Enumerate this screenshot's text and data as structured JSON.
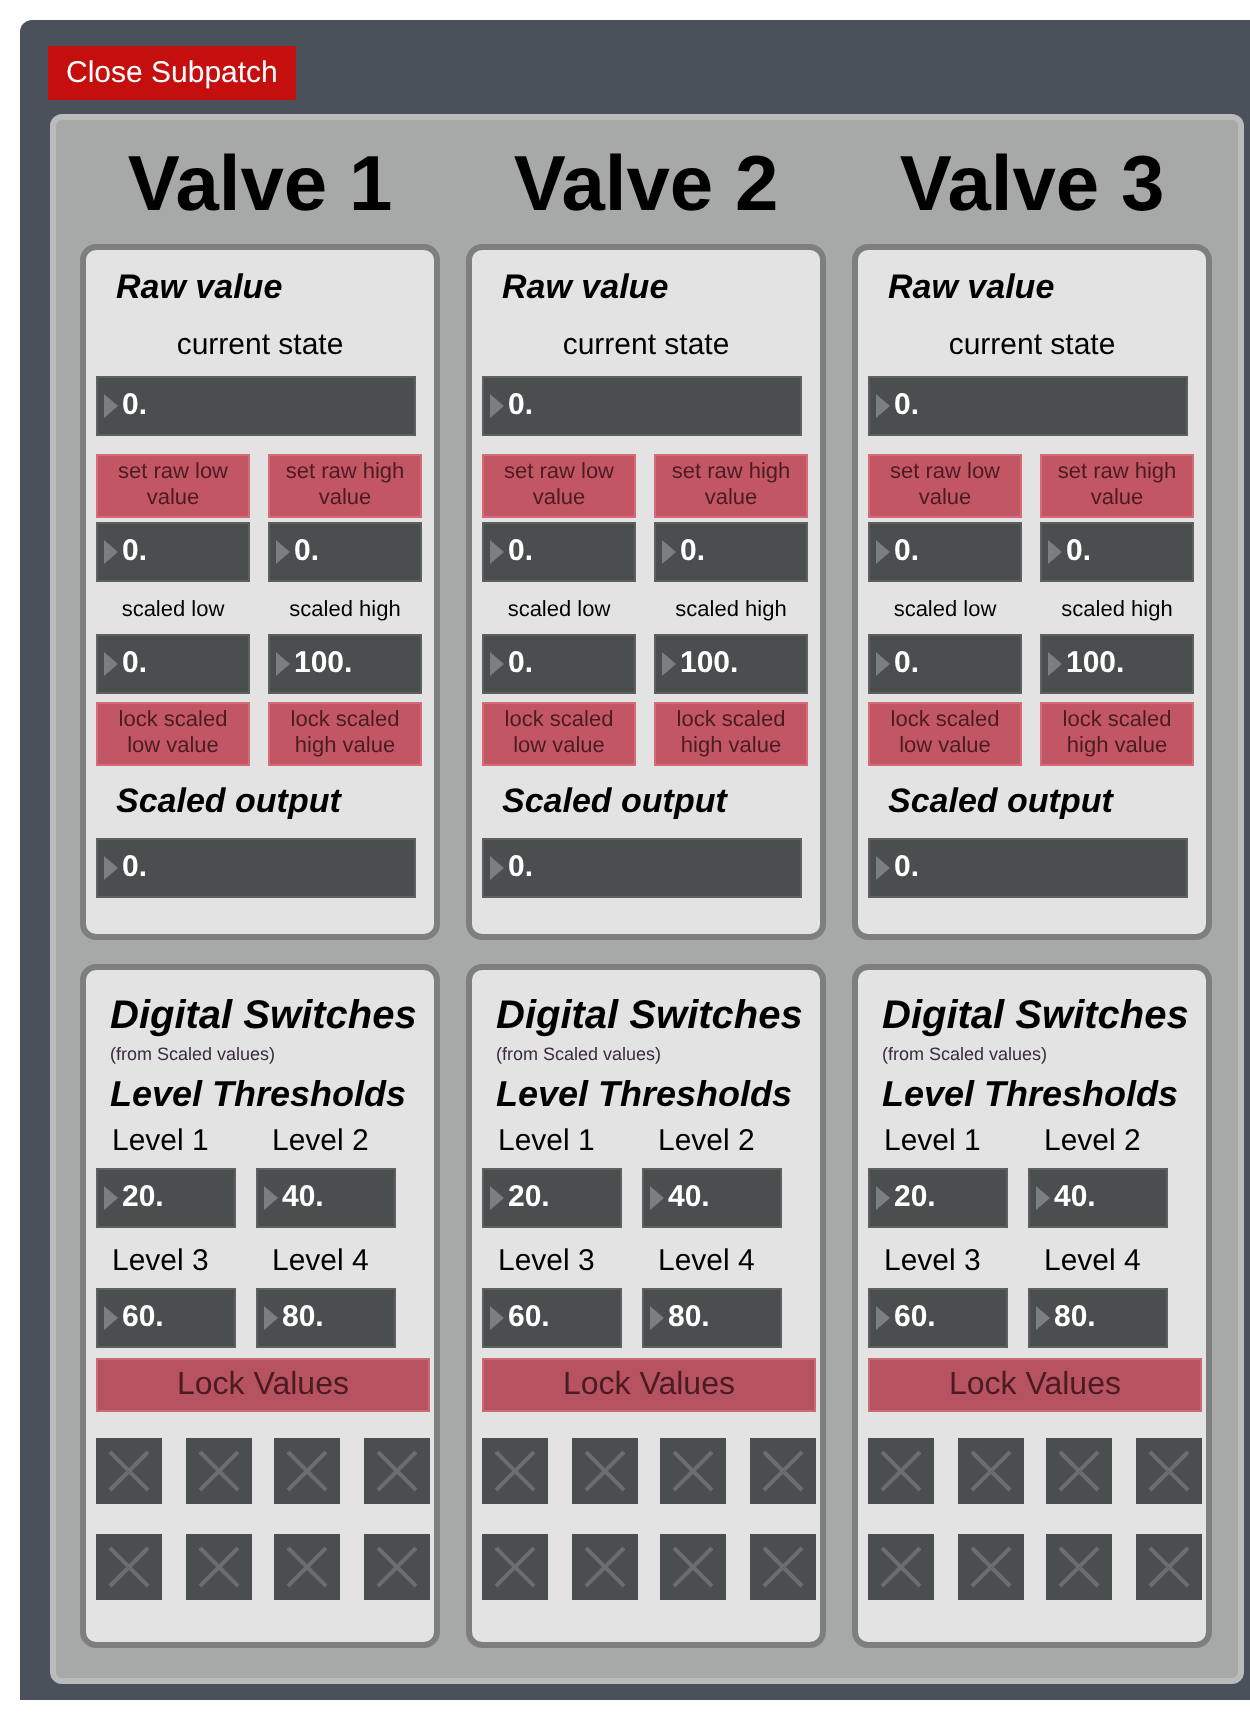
{
  "close_button": "Close Subpatch",
  "valves": [
    {
      "title": "Valve 1",
      "raw": {
        "heading": "Raw value",
        "current_label": "current state",
        "current": "0.",
        "set_low": "set raw low value",
        "set_high": "set raw high value",
        "raw_low": "0.",
        "raw_high": "0.",
        "scaled_low_label": "scaled low",
        "scaled_high_label": "scaled high",
        "scaled_low": "0.",
        "scaled_high": "100.",
        "lock_low": "lock scaled low value",
        "lock_high": "lock scaled high value",
        "output_heading": "Scaled output",
        "output": "0."
      },
      "switches": {
        "heading": "Digital Switches",
        "note": "(from Scaled values)",
        "thresholds_heading": "Level Thresholds",
        "levels": [
          {
            "label": "Level 1",
            "value": "20."
          },
          {
            "label": "Level 2",
            "value": "40."
          },
          {
            "label": "Level 3",
            "value": "60."
          },
          {
            "label": "Level 4",
            "value": "80."
          }
        ],
        "lock_button": "Lock Values",
        "toggles": [
          {
            "checked": false
          },
          {
            "checked": false
          },
          {
            "checked": false
          },
          {
            "checked": false
          },
          {
            "checked": false
          },
          {
            "checked": false
          },
          {
            "checked": false
          },
          {
            "checked": false
          }
        ]
      }
    },
    {
      "title": "Valve 2",
      "raw": {
        "heading": "Raw value",
        "current_label": "current state",
        "current": "0.",
        "set_low": "set raw low value",
        "set_high": "set raw high value",
        "raw_low": "0.",
        "raw_high": "0.",
        "scaled_low_label": "scaled low",
        "scaled_high_label": "scaled high",
        "scaled_low": "0.",
        "scaled_high": "100.",
        "lock_low": "lock scaled low value",
        "lock_high": "lock scaled high value",
        "output_heading": "Scaled output",
        "output": "0."
      },
      "switches": {
        "heading": "Digital Switches",
        "note": "(from Scaled values)",
        "thresholds_heading": "Level Thresholds",
        "levels": [
          {
            "label": "Level 1",
            "value": "20."
          },
          {
            "label": "Level 2",
            "value": "40."
          },
          {
            "label": "Level 3",
            "value": "60."
          },
          {
            "label": "Level 4",
            "value": "80."
          }
        ],
        "lock_button": "Lock Values",
        "toggles": [
          {
            "checked": false
          },
          {
            "checked": false
          },
          {
            "checked": false
          },
          {
            "checked": false
          },
          {
            "checked": false
          },
          {
            "checked": false
          },
          {
            "checked": false
          },
          {
            "checked": false
          }
        ]
      }
    },
    {
      "title": "Valve 3",
      "raw": {
        "heading": "Raw value",
        "current_label": "current state",
        "current": "0.",
        "set_low": "set raw low value",
        "set_high": "set raw high value",
        "raw_low": "0.",
        "raw_high": "0.",
        "scaled_low_label": "scaled low",
        "scaled_high_label": "scaled high",
        "scaled_low": "0.",
        "scaled_high": "100.",
        "lock_low": "lock scaled low value",
        "lock_high": "lock scaled high value",
        "output_heading": "Scaled output",
        "output": "0."
      },
      "switches": {
        "heading": "Digital Switches",
        "note": "(from Scaled values)",
        "thresholds_heading": "Level Thresholds",
        "levels": [
          {
            "label": "Level 1",
            "value": "20."
          },
          {
            "label": "Level 2",
            "value": "40."
          },
          {
            "label": "Level 3",
            "value": "60."
          },
          {
            "label": "Level 4",
            "value": "80."
          }
        ],
        "lock_button": "Lock Values",
        "toggles": [
          {
            "checked": false
          },
          {
            "checked": false
          },
          {
            "checked": false
          },
          {
            "checked": false
          },
          {
            "checked": false
          },
          {
            "checked": false
          },
          {
            "checked": false
          },
          {
            "checked": false
          }
        ]
      }
    }
  ]
}
